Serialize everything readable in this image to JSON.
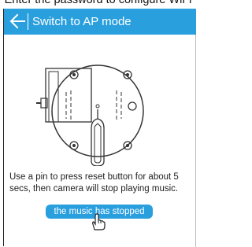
{
  "header_caption": "Enter the password to configure WiFi",
  "titlebar": {
    "back_icon": "arrow-left-icon",
    "title": "Switch to AP mode",
    "color": "#2a9fde"
  },
  "illustration": {
    "description_icon": "camera-reset-pin-icon"
  },
  "instructions": "Use a pin to press reset button for about 5 secs, then camera will stop playing music.",
  "status_button": {
    "label": "the music has stopped",
    "color": "#2a9fde"
  },
  "hand_icon": "pointing-hand-icon"
}
